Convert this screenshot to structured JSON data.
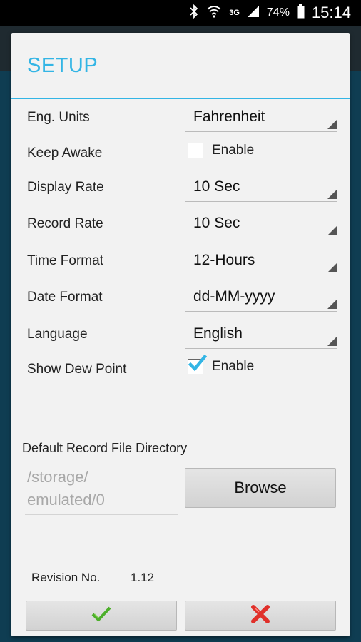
{
  "status_bar": {
    "battery": "74%",
    "time": "15:14",
    "network": "3G",
    "icons": [
      "bluetooth-icon",
      "wifi-icon",
      "signal-icon",
      "battery-icon"
    ]
  },
  "dialog": {
    "title": "SETUP",
    "settings": [
      {
        "label": "Eng. Units",
        "type": "select",
        "value": "Fahrenheit"
      },
      {
        "label": "Keep Awake",
        "type": "checkbox",
        "checked": false,
        "text": "Enable"
      },
      {
        "label": "Display Rate",
        "type": "select",
        "value": "10 Sec"
      },
      {
        "label": "Record Rate",
        "type": "select",
        "value": "10 Sec"
      },
      {
        "label": "Time Format",
        "type": "select",
        "value": "12-Hours"
      },
      {
        "label": "Date Format",
        "type": "select",
        "value": "dd-MM-yyyy"
      },
      {
        "label": "Language",
        "type": "select",
        "value": "English"
      },
      {
        "label": "Show Dew Point",
        "type": "checkbox",
        "checked": true,
        "text": "Enable"
      }
    ],
    "directory": {
      "label": "Default Record File Directory",
      "path_line1": "/storage/",
      "path_line2": "emulated/0",
      "browse_label": "Browse"
    },
    "revision": {
      "label": "Revision No.",
      "value": "1.12"
    },
    "actions": {
      "ok_icon": "checkmark-icon",
      "cancel_icon": "cross-icon"
    },
    "colors": {
      "accent": "#33b5e5",
      "ok": "#4caf2a",
      "cancel": "#e0302a"
    }
  }
}
